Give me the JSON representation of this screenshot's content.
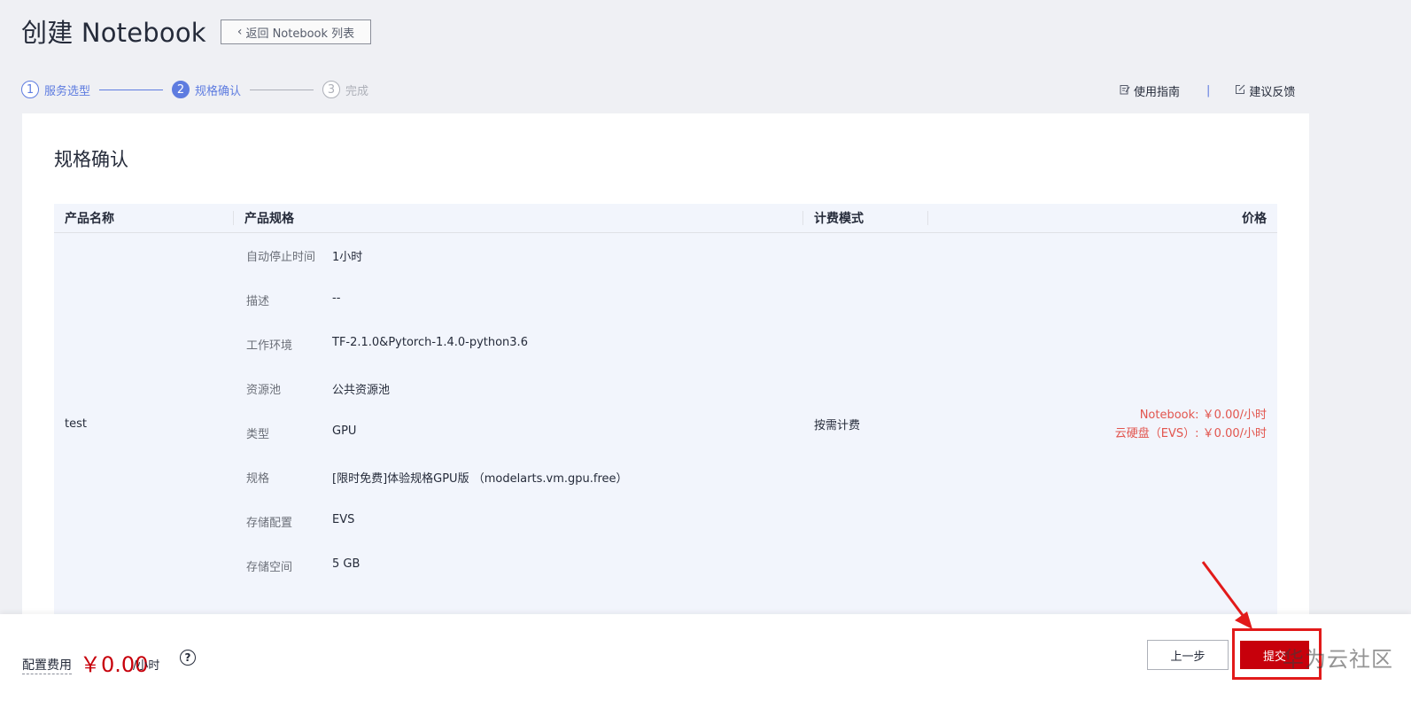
{
  "header": {
    "title": "创建 Notebook",
    "back_label": "返回 Notebook 列表"
  },
  "steps": [
    {
      "num": "1",
      "label": "服务选型",
      "state": "done"
    },
    {
      "num": "2",
      "label": "规格确认",
      "state": "active"
    },
    {
      "num": "3",
      "label": "完成",
      "state": "todo"
    }
  ],
  "top_links": {
    "guide": "使用指南",
    "feedback": "建议反馈"
  },
  "panel": {
    "title": "规格确认"
  },
  "table": {
    "headers": [
      "产品名称",
      "产品规格",
      "计费模式",
      "价格"
    ],
    "product_name": "test",
    "billing_mode": "按需计费",
    "specs": [
      {
        "label": "自动停止时间",
        "value": "1小时"
      },
      {
        "label": "描述",
        "value": "--"
      },
      {
        "label": "工作环境",
        "value": "TF-2.1.0&Pytorch-1.4.0-python3.6"
      },
      {
        "label": "资源池",
        "value": "公共资源池"
      },
      {
        "label": "类型",
        "value": "GPU"
      },
      {
        "label": "规格",
        "value": "[限时免费]体验规格GPU版 （modelarts.vm.gpu.free）"
      },
      {
        "label": "存储配置",
        "value": "EVS"
      },
      {
        "label": "存储空间",
        "value": "5 GB"
      }
    ],
    "price_lines": [
      "Notebook: ￥0.00/小时",
      "云硬盘（EVS）: ￥0.00/小时"
    ]
  },
  "footer": {
    "fee_label": "配置费用",
    "fee_amount": "￥0.00",
    "fee_unit": "/小时",
    "help": "?",
    "prev_label": "上一步",
    "submit_label": "提交",
    "watermark": "华为云社区"
  },
  "colors": {
    "accent": "#5e7ce0",
    "primary_button": "#c7000b",
    "price_text": "#e2554e",
    "annotation": "#e21a1a"
  }
}
